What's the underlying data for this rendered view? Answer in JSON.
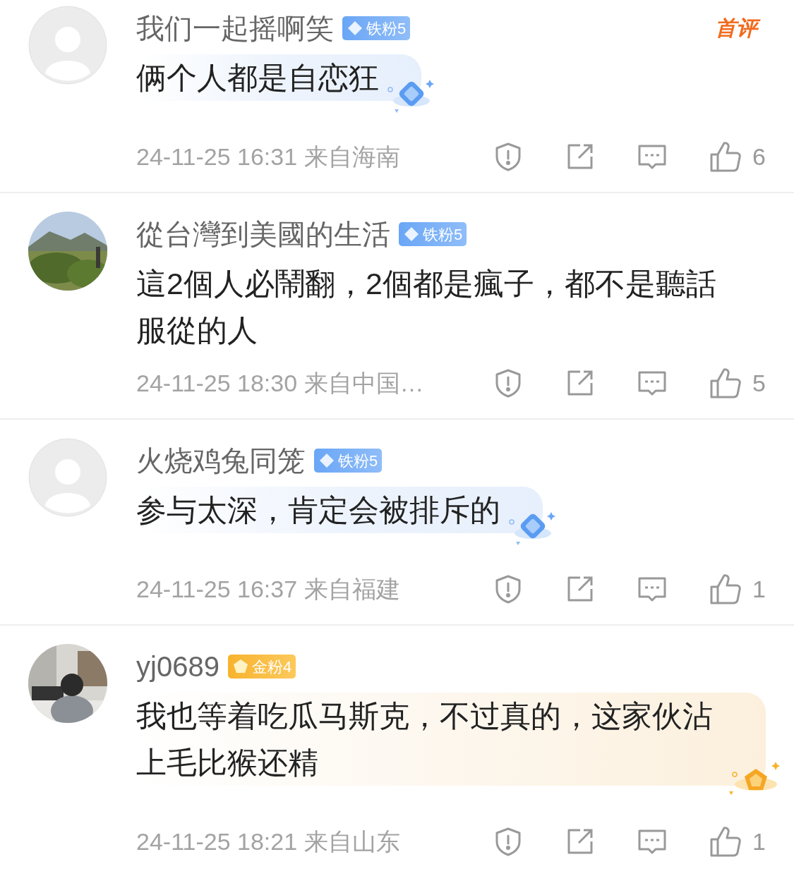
{
  "comments": [
    {
      "avatar": {
        "kind": "default"
      },
      "user": "我们一起摇啊笑",
      "badge": {
        "kind": "iron",
        "label": "铁粉5"
      },
      "first_label": "首评",
      "text": "俩个人都是自恋狂",
      "bubble": {
        "kind": "blue"
      },
      "time": "24-11-25 16:31",
      "location": "来自海南",
      "likes": "6"
    },
    {
      "user": "從台灣到美國的生活",
      "badge": {
        "kind": "iron",
        "label": "铁粉5"
      },
      "text": "這2個人必鬧翻，2個都是瘋子，都不是聽話服從的人",
      "time": "24-11-25 18:30",
      "location": "来自中国…",
      "likes": "5"
    },
    {
      "avatar": {
        "kind": "default"
      },
      "user": "火烧鸡兔同笼",
      "badge": {
        "kind": "iron",
        "label": "铁粉5"
      },
      "text": "参与太深，肯定会被排斥的",
      "bubble": {
        "kind": "blue"
      },
      "time": "24-11-25 16:37",
      "location": "来自福建",
      "likes": "1"
    },
    {
      "user": "yj0689",
      "badge": {
        "kind": "gold",
        "label": "金粉4"
      },
      "text": "我也等着吃瓜马斯克，不过真的，这家伙沾上毛比猴还精",
      "bubble": {
        "kind": "gold"
      },
      "time": "24-11-25 18:21",
      "location": "来自山东",
      "likes": "1"
    }
  ]
}
